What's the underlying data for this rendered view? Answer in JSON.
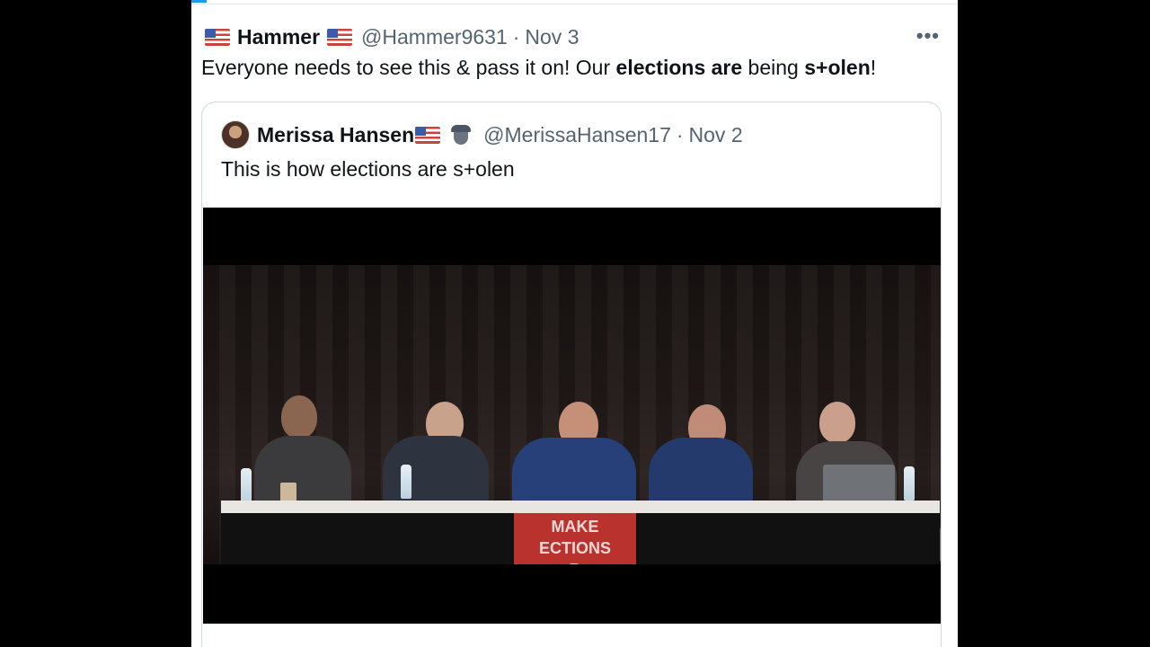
{
  "tweet": {
    "name": "Hammer",
    "handle": "@Hammer9631",
    "separator": "·",
    "date": "Nov 3",
    "more_label": "•••",
    "text_parts": [
      "Everyone needs to see this & pass it on! Our ",
      "elections are",
      " being ",
      "s+olen",
      "!"
    ]
  },
  "quoted_tweet": {
    "name": "Merissa Hansen",
    "handle": "@MerissaHansen17",
    "separator": "·",
    "date": "Nov 2",
    "text": "This is how elections are s+olen"
  },
  "video": {
    "banner_text": [
      "MAKE",
      "ECTIONS",
      "R"
    ]
  },
  "colors": {
    "background": "#000000",
    "card": "#ffffff",
    "secondary_text": "#536471",
    "border": "#cfd9de",
    "accent": "#1d9bf0"
  },
  "icons": [
    "us-flag-icon",
    "spy-icon",
    "more-options-icon"
  ]
}
